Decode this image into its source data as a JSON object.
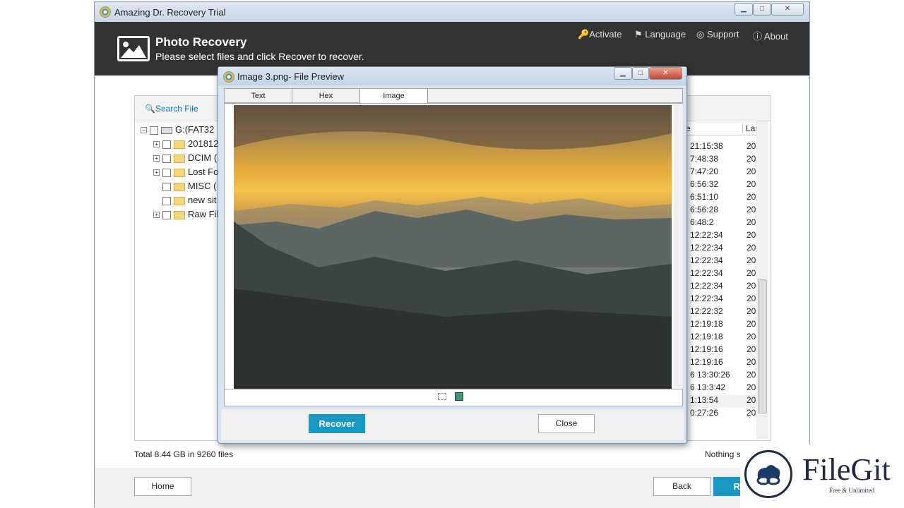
{
  "window": {
    "title": "Amazing Dr. Recovery Trial",
    "controls": [
      "minimize",
      "maximize",
      "close"
    ]
  },
  "header": {
    "title": "Photo Recovery",
    "subtitle": "Please select files and click Recover to recover.",
    "nav": [
      {
        "label": "Activate",
        "icon": "key-icon"
      },
      {
        "label": "Language",
        "icon": "flag-icon"
      },
      {
        "label": "Support",
        "icon": "lifebuoy-icon"
      },
      {
        "label": "About",
        "icon": "info-icon"
      }
    ]
  },
  "search": {
    "label": "Search File"
  },
  "tree": [
    {
      "label": "G:(FAT32 1",
      "expander": "−"
    },
    {
      "label": "201812",
      "expander": "+"
    },
    {
      "label": "DCIM (",
      "expander": "+"
    },
    {
      "label": "Lost Fo",
      "expander": "+"
    },
    {
      "label": "MISC (",
      "expander": ""
    },
    {
      "label": "new sit",
      "expander": ""
    },
    {
      "label": "Raw Fil",
      "expander": "+"
    }
  ],
  "list": {
    "columns": [
      "e",
      "Las"
    ],
    "rows": [
      [
        "21:15:38",
        "20"
      ],
      [
        "7:48:38",
        "20"
      ],
      [
        "7:47:20",
        "20"
      ],
      [
        "6:56:32",
        "20"
      ],
      [
        "6:51:10",
        "20"
      ],
      [
        "6:56:28",
        "20"
      ],
      [
        "6:48:2",
        "20"
      ],
      [
        "12:22:34",
        "20"
      ],
      [
        "12:22:34",
        "20"
      ],
      [
        "12:22:34",
        "20"
      ],
      [
        "12:22:34",
        "20"
      ],
      [
        "12:22:34",
        "20"
      ],
      [
        "12:22:34",
        "20"
      ],
      [
        "12:22:32",
        "20"
      ],
      [
        "12:19:18",
        "20"
      ],
      [
        "12:19:18",
        "20"
      ],
      [
        "12:19:16",
        "20"
      ],
      [
        "12:19:16",
        "20"
      ],
      [
        "6 13:30:26",
        "20"
      ],
      [
        "6 13:3:42",
        "20"
      ],
      [
        "1:13:54",
        "20"
      ],
      [
        "0:27:26",
        "20"
      ]
    ]
  },
  "status": {
    "total": "Total 8.44 GB in 9260 files",
    "selected": "Nothing s"
  },
  "footer": {
    "home": "Home",
    "back": "Back",
    "recover": "Rec"
  },
  "dialog": {
    "title": "Image 3.png- File Preview",
    "tabs": [
      "Text",
      "Hex",
      "Image"
    ],
    "active_tab": "Image",
    "recover": "Recover",
    "close": "Close"
  },
  "watermark": {
    "brand": "FileGit",
    "tagline": "Free & Unlimited"
  },
  "colors": {
    "accent": "#1a98c4",
    "header": "#333333"
  }
}
